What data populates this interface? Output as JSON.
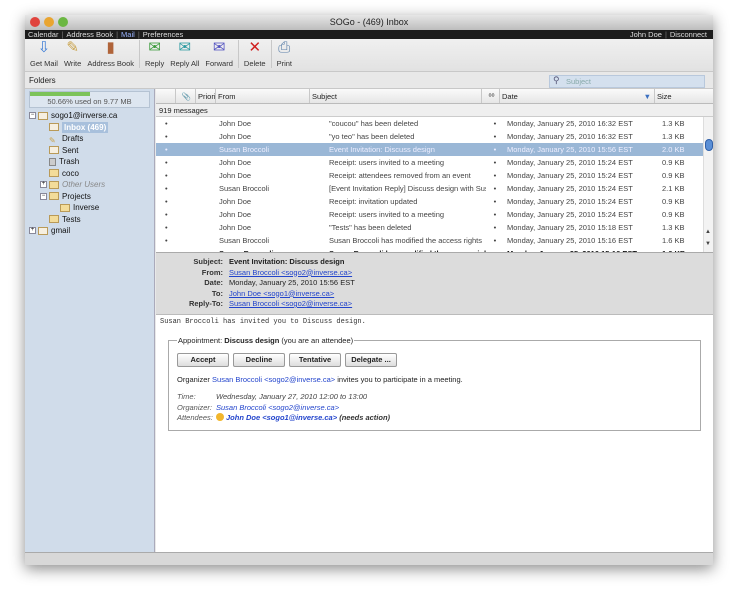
{
  "window": {
    "title": "SOGo - (469) Inbox"
  },
  "nav": {
    "items": [
      "Calendar",
      "Address Book",
      "Mail",
      "Preferences"
    ],
    "active": "Mail",
    "user": "John Doe",
    "disconnect": "Disconnect"
  },
  "toolbar": {
    "buttons": [
      {
        "label": "Get Mail",
        "icon": "get-mail-icon"
      },
      {
        "label": "Write",
        "icon": "pencil-icon"
      },
      {
        "label": "Address Book",
        "icon": "address-book-icon"
      },
      {
        "label": "Reply",
        "icon": "reply-icon"
      },
      {
        "label": "Reply All",
        "icon": "reply-all-icon"
      },
      {
        "label": "Forward",
        "icon": "forward-icon"
      },
      {
        "label": "Delete",
        "icon": "delete-icon"
      },
      {
        "label": "Print",
        "icon": "print-icon"
      }
    ]
  },
  "folders_label": "Folders",
  "search": {
    "placeholder": "Subject"
  },
  "quota": {
    "text": "50.66% used on 9.77 MB",
    "percent": 50.66
  },
  "tree": {
    "account": "sogo1@inverse.ca",
    "inbox": "Inbox (469)",
    "drafts": "Drafts",
    "sent": "Sent",
    "trash": "Trash",
    "coco": "coco",
    "other_users": "Other Users",
    "projects": "Projects",
    "inverse": "Inverse",
    "tests": "Tests",
    "gmail": "gmail"
  },
  "list": {
    "columns": [
      "",
      "Priorit",
      "From",
      "Subject",
      "",
      "Date",
      "Size"
    ],
    "count": "919 messages",
    "rows": [
      {
        "from": "John Doe",
        "subject": "\"coucou\" has been deleted",
        "date": "Monday, January 25, 2010 16:32 EST",
        "size": "1.3 KB"
      },
      {
        "from": "John Doe",
        "subject": "\"yo teo\" has been deleted",
        "date": "Monday, January 25, 2010 16:32 EST",
        "size": "1.3 KB"
      },
      {
        "from": "Susan Broccoli",
        "subject": "Event Invitation: Discuss design",
        "date": "Monday, January 25, 2010 15:56 EST",
        "size": "2.0 KB",
        "selected": true
      },
      {
        "from": "John Doe",
        "subject": "Receipt: users invited to a meeting",
        "date": "Monday, January 25, 2010 15:24 EST",
        "size": "0.9 KB"
      },
      {
        "from": "John Doe",
        "subject": "Receipt: attendees removed from an event",
        "date": "Monday, January 25, 2010 15:24 EST",
        "size": "0.9 KB"
      },
      {
        "from": "Susan Broccoli",
        "subject": "[Event Invitation Reply] Discuss design with Susan",
        "date": "Monday, January 25, 2010 15:24 EST",
        "size": "2.1 KB"
      },
      {
        "from": "John Doe",
        "subject": "Receipt: invitation updated",
        "date": "Monday, January 25, 2010 15:24 EST",
        "size": "0.9 KB"
      },
      {
        "from": "John Doe",
        "subject": "Receipt: users invited to a meeting",
        "date": "Monday, January 25, 2010 15:24 EST",
        "size": "0.9 KB"
      },
      {
        "from": "John Doe",
        "subject": "\"Tests\" has been deleted",
        "date": "Monday, January 25, 2010 15:18 EST",
        "size": "1.3 KB"
      },
      {
        "from": "Susan Broccoli",
        "subject": "Susan Broccoli has modified the access rights",
        "date": "Monday, January 25, 2010 15:16 EST",
        "size": "1.6 KB"
      },
      {
        "from": "Susan Broccoli",
        "subject": "Susan Broccoli has modified the access rights",
        "date": "Monday, January 25, 2010 15:16 EST",
        "size": "1.6 KB",
        "unread": true
      }
    ]
  },
  "message": {
    "labels": {
      "subject": "Subject:",
      "from": "From:",
      "date": "Date:",
      "to": "To:",
      "reply_to": "Reply-To:"
    },
    "subject": "Event Invitation: Discuss design",
    "from": "Susan Broccoli <sogo2@inverse.ca>",
    "date": "Monday, January 25, 2010 15:56 EST",
    "to": "John Doe <sogo1@inverse.ca>",
    "reply_to": "Susan Broccoli <sogo2@inverse.ca>",
    "body": "Susan Broccoli has invited you to Discuss design.",
    "appt": {
      "prefix": "Appointment:",
      "title": "Discuss design",
      "suffix": "(you are an attendee)",
      "buttons": [
        "Accept",
        "Decline",
        "Tentative",
        "Delegate ..."
      ],
      "org_prefix": "Organizer",
      "organizer": "Susan Broccoli <sogo2@inverse.ca>",
      "org_suffix": "invites you to participate in a meeting.",
      "time_label": "Time:",
      "time": "Wednesday, January 27, 2010 12:00 to 13:00",
      "organizer_label": "Organizer:",
      "attendees_label": "Attendees:",
      "attendee": "John Doe <sogo1@inverse.ca>",
      "attendee_status": "(needs action)"
    }
  }
}
